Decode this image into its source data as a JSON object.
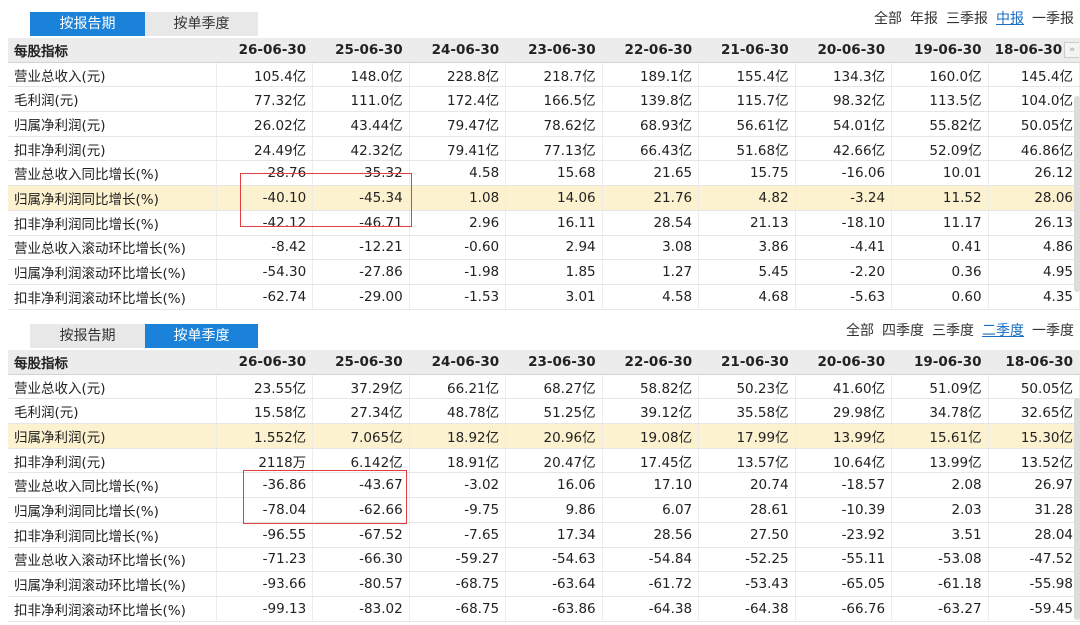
{
  "panels": [
    {
      "tabs": [
        {
          "label": "按报告期",
          "active": true
        },
        {
          "label": "按单季度",
          "active": false
        }
      ],
      "filters": [
        {
          "label": "全部",
          "selected": false
        },
        {
          "label": "年报",
          "selected": false
        },
        {
          "label": "三季报",
          "selected": false
        },
        {
          "label": "中报",
          "selected": true
        },
        {
          "label": "一季报",
          "selected": false
        }
      ],
      "header": "每股指标",
      "columns": [
        "26-06-30",
        "25-06-30",
        "24-06-30",
        "23-06-30",
        "22-06-30",
        "21-06-30",
        "20-06-30",
        "19-06-30",
        "18-06-30"
      ],
      "rows": [
        {
          "label": "营业总收入(元)",
          "values": [
            "105.4亿",
            "148.0亿",
            "228.8亿",
            "218.7亿",
            "189.1亿",
            "155.4亿",
            "134.3亿",
            "160.0亿",
            "145.4亿"
          ]
        },
        {
          "label": "毛利润(元)",
          "values": [
            "77.32亿",
            "111.0亿",
            "172.4亿",
            "166.5亿",
            "139.8亿",
            "115.7亿",
            "98.32亿",
            "113.5亿",
            "104.0亿"
          ]
        },
        {
          "label": "归属净利润(元)",
          "values": [
            "26.02亿",
            "43.44亿",
            "79.47亿",
            "78.62亿",
            "68.93亿",
            "56.61亿",
            "54.01亿",
            "55.82亿",
            "50.05亿"
          ]
        },
        {
          "label": "扣非净利润(元)",
          "values": [
            "24.49亿",
            "42.32亿",
            "79.41亿",
            "77.13亿",
            "66.43亿",
            "51.68亿",
            "42.66亿",
            "52.09亿",
            "46.86亿"
          ]
        },
        {
          "label": "营业总收入同比增长(%)",
          "values": [
            "-28.76",
            "-35.32",
            "4.58",
            "15.68",
            "21.65",
            "15.75",
            "-16.06",
            "10.01",
            "26.12"
          ]
        },
        {
          "label": "归属净利润同比增长(%)",
          "values": [
            "-40.10",
            "-45.34",
            "1.08",
            "14.06",
            "21.76",
            "4.82",
            "-3.24",
            "11.52",
            "28.06"
          ],
          "highlight": true
        },
        {
          "label": "扣非净利润同比增长(%)",
          "values": [
            "-42.12",
            "-46.71",
            "2.96",
            "16.11",
            "28.54",
            "21.13",
            "-18.10",
            "11.17",
            "26.13"
          ]
        },
        {
          "label": "营业总收入滚动环比增长(%)",
          "values": [
            "-8.42",
            "-12.21",
            "-0.60",
            "2.94",
            "3.08",
            "3.86",
            "-4.41",
            "0.41",
            "4.86"
          ]
        },
        {
          "label": "归属净利润滚动环比增长(%)",
          "values": [
            "-54.30",
            "-27.86",
            "-1.98",
            "1.85",
            "1.27",
            "5.45",
            "-2.20",
            "0.36",
            "4.95"
          ]
        },
        {
          "label": "扣非净利润滚动环比增长(%)",
          "values": [
            "-62.74",
            "-29.00",
            "-1.53",
            "3.01",
            "4.58",
            "4.68",
            "-5.63",
            "0.60",
            "4.35"
          ]
        }
      ]
    },
    {
      "tabs": [
        {
          "label": "按报告期",
          "active": false
        },
        {
          "label": "按单季度",
          "active": true
        }
      ],
      "filters": [
        {
          "label": "全部",
          "selected": false
        },
        {
          "label": "四季度",
          "selected": false
        },
        {
          "label": "三季度",
          "selected": false
        },
        {
          "label": "二季度",
          "selected": true
        },
        {
          "label": "一季度",
          "selected": false
        }
      ],
      "header": "每股指标",
      "columns": [
        "26-06-30",
        "25-06-30",
        "24-06-30",
        "23-06-30",
        "22-06-30",
        "21-06-30",
        "20-06-30",
        "19-06-30",
        "18-06-30"
      ],
      "rows": [
        {
          "label": "营业总收入(元)",
          "values": [
            "23.55亿",
            "37.29亿",
            "66.21亿",
            "68.27亿",
            "58.82亿",
            "50.23亿",
            "41.60亿",
            "51.09亿",
            "50.05亿"
          ]
        },
        {
          "label": "毛利润(元)",
          "values": [
            "15.58亿",
            "27.34亿",
            "48.78亿",
            "51.25亿",
            "39.12亿",
            "35.58亿",
            "29.98亿",
            "34.78亿",
            "32.65亿"
          ]
        },
        {
          "label": "归属净利润(元)",
          "values": [
            "1.552亿",
            "7.065亿",
            "18.92亿",
            "20.96亿",
            "19.08亿",
            "17.99亿",
            "13.99亿",
            "15.61亿",
            "15.30亿"
          ],
          "highlight": true
        },
        {
          "label": "扣非净利润(元)",
          "values": [
            "2118万",
            "6.142亿",
            "18.91亿",
            "20.47亿",
            "17.45亿",
            "13.57亿",
            "10.64亿",
            "13.99亿",
            "13.52亿"
          ]
        },
        {
          "label": "营业总收入同比增长(%)",
          "values": [
            "-36.86",
            "-43.67",
            "-3.02",
            "16.06",
            "17.10",
            "20.74",
            "-18.57",
            "2.08",
            "26.97"
          ]
        },
        {
          "label": "归属净利润同比增长(%)",
          "values": [
            "-78.04",
            "-62.66",
            "-9.75",
            "9.86",
            "6.07",
            "28.61",
            "-10.39",
            "2.03",
            "31.28"
          ]
        },
        {
          "label": "扣非净利润同比增长(%)",
          "values": [
            "-96.55",
            "-67.52",
            "-7.65",
            "17.34",
            "28.56",
            "27.50",
            "-23.92",
            "3.51",
            "28.04"
          ]
        },
        {
          "label": "营业总收入滚动环比增长(%)",
          "values": [
            "-71.23",
            "-66.30",
            "-59.27",
            "-54.63",
            "-54.84",
            "-52.25",
            "-55.11",
            "-53.08",
            "-47.52"
          ]
        },
        {
          "label": "归属净利润滚动环比增长(%)",
          "values": [
            "-93.66",
            "-80.57",
            "-68.75",
            "-63.64",
            "-61.72",
            "-53.43",
            "-65.05",
            "-61.18",
            "-55.98"
          ]
        },
        {
          "label": "扣非净利润滚动环比增长(%)",
          "values": [
            "-99.13",
            "-83.02",
            "-68.75",
            "-63.86",
            "-64.38",
            "-64.38",
            "-66.76",
            "-63.27",
            "-59.45"
          ]
        }
      ]
    }
  ]
}
